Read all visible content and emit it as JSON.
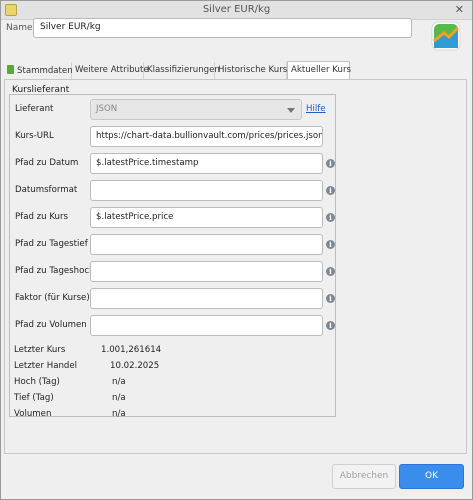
{
  "window": {
    "title": "Silver EUR/kg"
  },
  "name": {
    "label": "Name",
    "value": "Silver EUR/kg"
  },
  "tabs": [
    {
      "label": "Stammdaten"
    },
    {
      "label": "Weitere Attribute"
    },
    {
      "label": "Klassifizierungen"
    },
    {
      "label": "Historische Kurse"
    },
    {
      "label": "Aktueller Kurs"
    }
  ],
  "group": {
    "title": "Kurslieferant"
  },
  "provider": {
    "label": "Lieferant",
    "selected": "JSON",
    "help": "Hilfe"
  },
  "fields": {
    "url": {
      "label": "Kurs-URL",
      "value": "https://chart-data.bullionvault.com/prices/prices.json?&ver"
    },
    "date_path": {
      "label": "Pfad zu Datum",
      "value": "$.latestPrice.timestamp"
    },
    "date_format": {
      "label": "Datumsformat",
      "value": ""
    },
    "price_path": {
      "label": "Pfad zu Kurs",
      "value": "$.latestPrice.price"
    },
    "low_path": {
      "label": "Pfad zu Tagestief",
      "value": ""
    },
    "high_path": {
      "label": "Pfad zu Tageshoch",
      "value": ""
    },
    "factor": {
      "label": "Faktor (für Kurse)",
      "value": ""
    },
    "volume_path": {
      "label": "Pfad zu Volumen",
      "value": ""
    }
  },
  "stats": {
    "last_price": {
      "label": "Letzter Kurs",
      "value": "1.001,261614"
    },
    "last_trade": {
      "label": "Letzter Handel",
      "value": "10.02.2025"
    },
    "high": {
      "label": "Hoch (Tag)",
      "value": "n/a"
    },
    "low": {
      "label": "Tief (Tag)",
      "value": "n/a"
    },
    "volume": {
      "label": "Volumen",
      "value": "n/a"
    }
  },
  "buttons": {
    "cancel": "Abbrechen",
    "ok": "OK"
  },
  "colors": {
    "accent": "#3b8ded",
    "link": "#1a5fc8",
    "info": "#7d8794"
  },
  "icons": {
    "logo": "chart-logo-icon",
    "info": "info-icon",
    "tab": "document-icon"
  }
}
